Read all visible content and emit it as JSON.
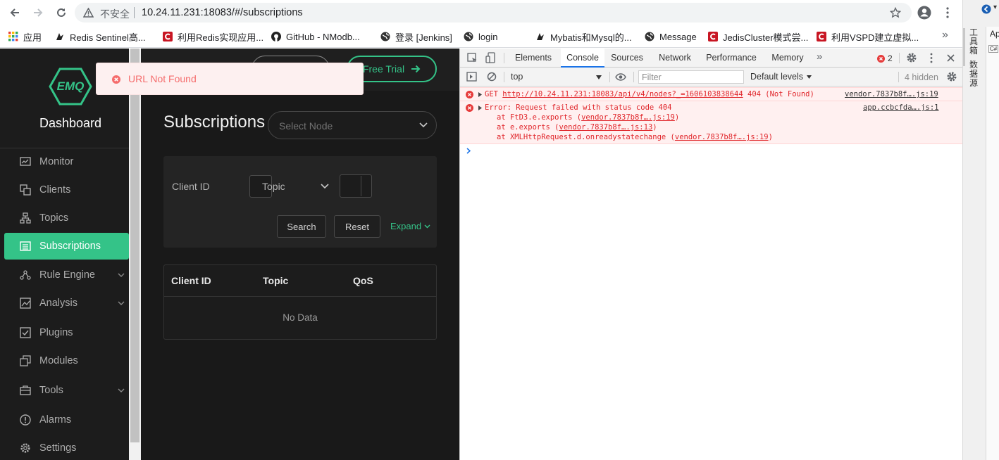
{
  "browser": {
    "security_text": "不安全",
    "url": "10.24.11.231:18083/#/subscriptions",
    "bookmarks": [
      {
        "label": "应用",
        "icon": "apps-grid-icon"
      },
      {
        "label": "Redis Sentinel高...",
        "icon": "mybatis-bird-icon"
      },
      {
        "label": "利用Redis实现应用...",
        "icon": "csdn-icon"
      },
      {
        "label": "GitHub - NModb...",
        "icon": "github-icon"
      },
      {
        "label": "登录 [Jenkins]",
        "icon": "globe-icon"
      },
      {
        "label": "login",
        "icon": "globe-icon"
      },
      {
        "label": "Mybatis和Mysql的...",
        "icon": "mybatis-bird-icon"
      },
      {
        "label": "Message",
        "icon": "globe-icon"
      },
      {
        "label": "JedisCluster模式尝...",
        "icon": "csdn-icon"
      },
      {
        "label": "利用VSPD建立虚拟...",
        "icon": "csdn-icon"
      }
    ]
  },
  "sidebar": {
    "logo_text": "EMQ",
    "title": "Dashboard",
    "items": [
      {
        "label": "Monitor",
        "icon": "monitor-icon",
        "active": false,
        "chevron": false
      },
      {
        "label": "Clients",
        "icon": "clients-icon",
        "active": false,
        "chevron": false
      },
      {
        "label": "Topics",
        "icon": "topics-icon",
        "active": false,
        "chevron": false
      },
      {
        "label": "Subscriptions",
        "icon": "subscriptions-icon",
        "active": true,
        "chevron": false
      },
      {
        "label": "Rule Engine",
        "icon": "rule-engine-icon",
        "active": false,
        "chevron": true
      },
      {
        "label": "Analysis",
        "icon": "analysis-icon",
        "active": false,
        "chevron": true
      },
      {
        "label": "Plugins",
        "icon": "plugins-icon",
        "active": false,
        "chevron": false
      },
      {
        "label": "Modules",
        "icon": "modules-icon",
        "active": false,
        "chevron": false
      },
      {
        "label": "Tools",
        "icon": "tools-icon",
        "active": false,
        "chevron": true
      },
      {
        "label": "Alarms",
        "icon": "alarms-icon",
        "active": false,
        "chevron": false
      },
      {
        "label": "Settings",
        "icon": "settings-icon",
        "active": false,
        "chevron": false
      }
    ]
  },
  "toast": {
    "message": "URL Not Found"
  },
  "header": {
    "free_trial": "Free Trial"
  },
  "page": {
    "title": "Subscriptions",
    "select_node_placeholder": "Select Node",
    "filter": {
      "client_id_label": "Client ID",
      "topic_label": "Topic",
      "search": "Search",
      "reset": "Reset",
      "expand": "Expand"
    },
    "table": {
      "columns": [
        "Client ID",
        "Topic",
        "QoS"
      ],
      "empty": "No Data"
    }
  },
  "devtools": {
    "tabs": [
      "Elements",
      "Console",
      "Sources",
      "Network",
      "Performance",
      "Memory"
    ],
    "active_tab": "Console",
    "error_count": "2",
    "context": "top",
    "filter_placeholder": "Filter",
    "levels": "Default levels",
    "hidden": "4 hidden",
    "console": {
      "get_line": {
        "method": "GET",
        "url": "http://10.24.11.231:18083/api/v4/nodes?_=1606103838644",
        "status": "404 (Not Found)",
        "source": "vendor.7837b8f….js:19"
      },
      "error": {
        "message": "Error: Request failed with status code 404",
        "source": "app.ccbcfda….js:1",
        "stack": [
          {
            "prefix": "at FtD3.e.exports (",
            "link": "vendor.7837b8f….js:19",
            "suffix": ")"
          },
          {
            "prefix": "at e.exports (",
            "link": "vendor.7837b8f….js:13",
            "suffix": ")"
          },
          {
            "prefix": "at XMLHttpRequest.d.onreadystatechange (",
            "link": "vendor.7837b8f….js:19",
            "suffix": ")"
          }
        ]
      }
    }
  },
  "right_strip": {
    "toolbox": "工具箱",
    "datasource": "数据源",
    "app_label": "Ap",
    "csharp": "C#"
  },
  "colors": {
    "accent_green": "#34c388",
    "error_red": "#e63b3b",
    "sidebar_bg": "#1c1c1c",
    "main_bg": "#191919"
  }
}
